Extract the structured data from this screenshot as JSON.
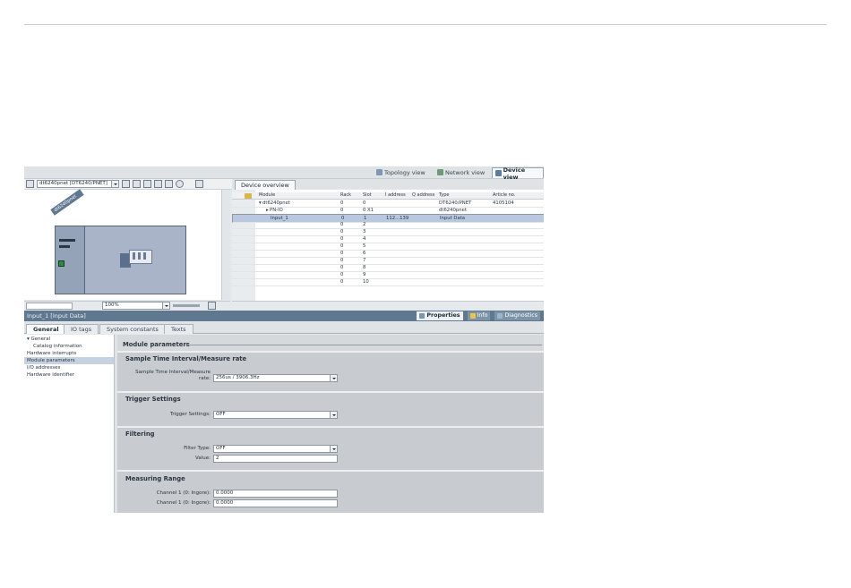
{
  "view_tabs": [
    {
      "label": "Topology view",
      "icon": "topology-icon",
      "active": false
    },
    {
      "label": "Network view",
      "icon": "network-icon",
      "active": false
    },
    {
      "label": "Device view",
      "icon": "device-icon",
      "active": true
    }
  ],
  "device_toolbar": {
    "device_select": "dt6240pnet [DT6240/PNET]"
  },
  "canvas": {
    "rack_label": "dt6240pnet",
    "zoom": "100%"
  },
  "overview": {
    "tab": "Device overview",
    "columns": [
      "Module",
      "Rack",
      "Slot",
      "I address",
      "Q address",
      "Type",
      "Article no."
    ],
    "rows": [
      {
        "module": "dt6240pnet",
        "rack": "0",
        "slot": "0",
        "i_address": "",
        "q_address": "",
        "type": "DT6240/PNET",
        "article": "4105104",
        "level": 1,
        "expand": "down"
      },
      {
        "module": "PN-IO",
        "rack": "0",
        "slot": "0 X1",
        "i_address": "",
        "q_address": "",
        "type": "dt6240pnet",
        "article": "",
        "level": 2,
        "expand": "right"
      },
      {
        "module": "Input_1",
        "rack": "0",
        "slot": "1",
        "i_address": "112...139",
        "q_address": "",
        "type": "Input Data",
        "article": "",
        "level": 1,
        "selected": true
      },
      {
        "module": "",
        "rack": "0",
        "slot": "2",
        "i_address": "",
        "q_address": "",
        "type": "",
        "article": ""
      },
      {
        "module": "",
        "rack": "0",
        "slot": "3",
        "i_address": "",
        "q_address": "",
        "type": "",
        "article": ""
      },
      {
        "module": "",
        "rack": "0",
        "slot": "4",
        "i_address": "",
        "q_address": "",
        "type": "",
        "article": ""
      },
      {
        "module": "",
        "rack": "0",
        "slot": "5",
        "i_address": "",
        "q_address": "",
        "type": "",
        "article": ""
      },
      {
        "module": "",
        "rack": "0",
        "slot": "6",
        "i_address": "",
        "q_address": "",
        "type": "",
        "article": ""
      },
      {
        "module": "",
        "rack": "0",
        "slot": "7",
        "i_address": "",
        "q_address": "",
        "type": "",
        "article": ""
      },
      {
        "module": "",
        "rack": "0",
        "slot": "8",
        "i_address": "",
        "q_address": "",
        "type": "",
        "article": ""
      },
      {
        "module": "",
        "rack": "0",
        "slot": "9",
        "i_address": "",
        "q_address": "",
        "type": "",
        "article": ""
      },
      {
        "module": "",
        "rack": "0",
        "slot": "10",
        "i_address": "",
        "q_address": "",
        "type": "",
        "article": ""
      }
    ]
  },
  "properties": {
    "title": "Input_1 [Input Data]",
    "right_tabs": [
      {
        "label": "Properties",
        "icon": "properties-icon",
        "active": true
      },
      {
        "label": "Info",
        "icon": "info-icon",
        "active": false
      },
      {
        "label": "Diagnostics",
        "icon": "diagnostics-icon",
        "active": false
      }
    ],
    "tabs": [
      "General",
      "IO tags",
      "System constants",
      "Texts"
    ],
    "nav": [
      {
        "label": "General",
        "sub": false,
        "current": false,
        "expand": true
      },
      {
        "label": "Catalog information",
        "sub": true,
        "current": false
      },
      {
        "label": "Hardware interrupts",
        "sub": false,
        "current": false
      },
      {
        "label": "Module parameters",
        "sub": false,
        "current": true
      },
      {
        "label": "I/O addresses",
        "sub": false,
        "current": false
      },
      {
        "label": "Hardware identifier",
        "sub": false,
        "current": false
      }
    ],
    "heading": "Module parameters",
    "sections": {
      "sample": {
        "title": "Sample Time Interval/Measure rate",
        "label_1": "Sample Time Interval/Measure",
        "label_2": "rate:",
        "value": "256us / 3906.3Hz"
      },
      "trigger": {
        "title": "Trigger Settings",
        "label": "Trigger Settings:",
        "value": "OFF"
      },
      "filtering": {
        "title": "Filtering",
        "type_label": "Filter Type:",
        "type_value": "OFF",
        "value_label": "Value:",
        "value_value": "2"
      },
      "range": {
        "title": "Measuring Range",
        "ch1_label": "Channel 1 (0: Ingore):",
        "ch1_value": "0.0000",
        "ch2_label": "Channel 1 (0: Ingore):",
        "ch2_value": "0.0000"
      }
    }
  }
}
